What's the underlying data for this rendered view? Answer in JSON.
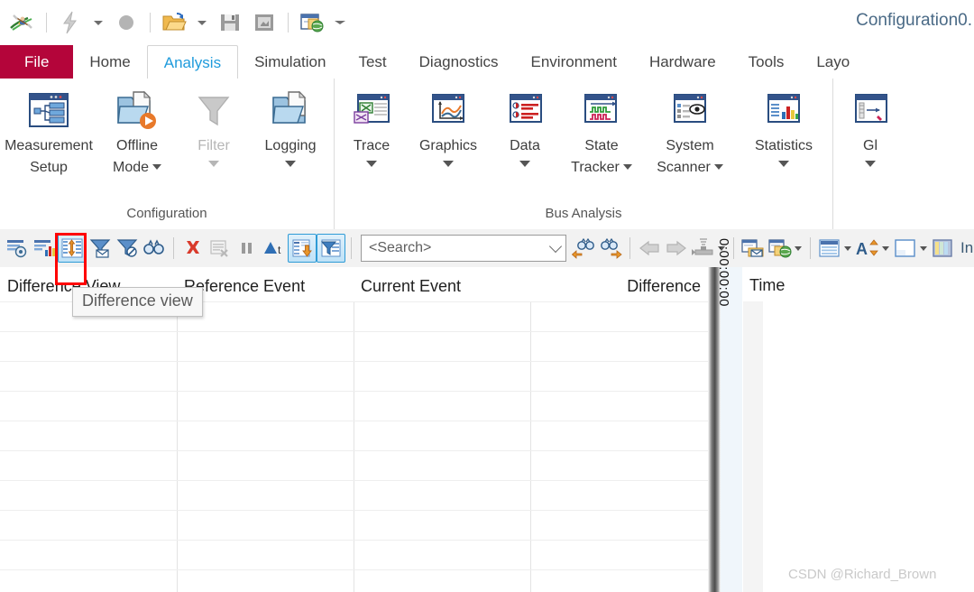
{
  "window": {
    "title": "Configuration0."
  },
  "quick_access": {
    "items": [
      {
        "name": "app-logo-icon",
        "label": "CANoe"
      },
      {
        "name": "flash-icon",
        "label": "Flash"
      },
      {
        "name": "flash-dropdown-caret",
        "label": ""
      },
      {
        "name": "stop-icon",
        "label": "Stop"
      },
      {
        "name": "open-folder-icon",
        "label": "Open"
      },
      {
        "name": "open-dropdown-caret",
        "label": ""
      },
      {
        "name": "save-icon",
        "label": "Save"
      },
      {
        "name": "save-as-icon",
        "label": "Save As"
      },
      {
        "name": "configuration-web-icon",
        "label": "Configuration"
      },
      {
        "name": "customize-qat-caret",
        "label": "Customize Quick Access Toolbar"
      }
    ]
  },
  "tabs": [
    {
      "label": "File",
      "state": "file"
    },
    {
      "label": "Home",
      "state": "normal"
    },
    {
      "label": "Analysis",
      "state": "active"
    },
    {
      "label": "Simulation",
      "state": "normal"
    },
    {
      "label": "Test",
      "state": "normal"
    },
    {
      "label": "Diagnostics",
      "state": "normal"
    },
    {
      "label": "Environment",
      "state": "normal"
    },
    {
      "label": "Hardware",
      "state": "normal"
    },
    {
      "label": "Tools",
      "state": "normal"
    },
    {
      "label": "Layo",
      "state": "normal"
    }
  ],
  "ribbon": {
    "groups": [
      {
        "title": "Configuration",
        "buttons": [
          {
            "label_line1": "Measurement",
            "label_line2": "Setup",
            "icon": "measurement-setup-icon",
            "dropdown": "none",
            "disabled": false
          },
          {
            "label_line1": "Offline",
            "label_line2": "Mode",
            "icon": "offline-mode-icon",
            "dropdown": "inline",
            "disabled": false
          },
          {
            "label_line1": "Filter",
            "label_line2": "",
            "icon": "filter-icon",
            "dropdown": "below",
            "disabled": true
          },
          {
            "label_line1": "Logging",
            "label_line2": "",
            "icon": "logging-icon",
            "dropdown": "below",
            "disabled": false
          }
        ]
      },
      {
        "title": "Bus Analysis",
        "buttons": [
          {
            "label_line1": "Trace",
            "label_line2": "",
            "icon": "trace-icon",
            "dropdown": "below",
            "disabled": false
          },
          {
            "label_line1": "Graphics",
            "label_line2": "",
            "icon": "graphics-icon",
            "dropdown": "below",
            "disabled": false
          },
          {
            "label_line1": "Data",
            "label_line2": "",
            "icon": "data-icon",
            "dropdown": "below",
            "disabled": false
          },
          {
            "label_line1": "State",
            "label_line2": "Tracker",
            "icon": "state-tracker-icon",
            "dropdown": "inline",
            "disabled": false
          },
          {
            "label_line1": "System",
            "label_line2": "Scanner",
            "icon": "system-scanner-icon",
            "dropdown": "inline",
            "disabled": false
          },
          {
            "label_line1": "Statistics",
            "label_line2": "",
            "icon": "statistics-icon",
            "dropdown": "below",
            "disabled": false
          }
        ]
      },
      {
        "title": "",
        "buttons": [
          {
            "label_line1": "Gl",
            "label_line2": "",
            "icon": "gps-icon",
            "dropdown": "below",
            "disabled": false
          }
        ]
      }
    ]
  },
  "toolbar": {
    "buttons": [
      {
        "name": "trace-config-icon",
        "checked": false
      },
      {
        "name": "statistics-view-icon",
        "checked": false
      },
      {
        "name": "difference-view-icon",
        "checked": true
      },
      {
        "name": "filter-message-icon",
        "checked": false
      },
      {
        "name": "filter-remove-icon",
        "checked": false
      },
      {
        "name": "find-icon",
        "checked": false
      },
      {
        "name": "clear-all-icon",
        "checked": false
      },
      {
        "name": "clear-list-icon",
        "checked": false
      },
      {
        "name": "pause-icon",
        "checked": false
      },
      {
        "name": "sort-at-icon",
        "checked": false
      },
      {
        "name": "scroll-to-end-icon",
        "checked": true
      },
      {
        "name": "analysis-filter-icon",
        "checked": true
      }
    ],
    "search": {
      "placeholder": "<Search>"
    },
    "nav_buttons": [
      {
        "name": "search-prev-icon"
      },
      {
        "name": "search-next-icon"
      },
      {
        "name": "back-arrow-icon"
      },
      {
        "name": "forward-arrow-icon"
      },
      {
        "name": "marker-icon"
      }
    ],
    "right_buttons": [
      {
        "name": "export-message-icon"
      },
      {
        "name": "export-web-icon"
      },
      {
        "name": "row-layout-icon"
      },
      {
        "name": "font-size-icon"
      },
      {
        "name": "window-layout-icon"
      },
      {
        "name": "column-setup-icon"
      }
    ],
    "right_label": "In"
  },
  "tooltip": {
    "text": "Difference view"
  },
  "grid": {
    "columns": [
      {
        "label": "Difference View"
      },
      {
        "label": "Reference Event"
      },
      {
        "label": "Current Event"
      },
      {
        "label": "Difference"
      }
    ],
    "rows": []
  },
  "time_panel": {
    "header": "Time",
    "ruler_label": "0:00:00:00"
  },
  "watermark": {
    "text": "CSDN @Richard_Brown"
  },
  "colors": {
    "file_tab": "#b4053a",
    "active_tab_text": "#1f9bdc",
    "annotation": "#ff0000",
    "title_text": "#4a6a86"
  }
}
